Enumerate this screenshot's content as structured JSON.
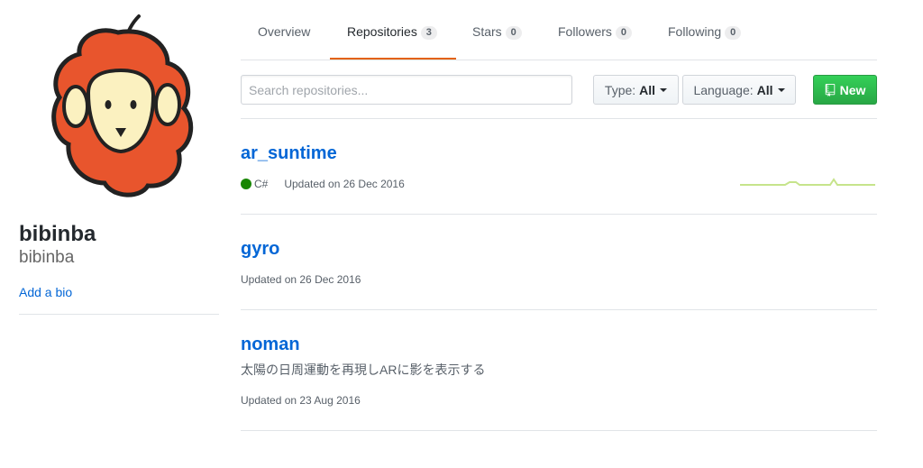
{
  "profile": {
    "fullname": "bibinba",
    "username": "bibinba",
    "add_bio": "Add a bio"
  },
  "tabs": [
    {
      "label": "Overview"
    },
    {
      "label": "Repositories",
      "count": "3"
    },
    {
      "label": "Stars",
      "count": "0"
    },
    {
      "label": "Followers",
      "count": "0"
    },
    {
      "label": "Following",
      "count": "0"
    }
  ],
  "selected_tab": "Repositories",
  "search": {
    "placeholder": "Search repositories..."
  },
  "filters": {
    "type_label": "Type:",
    "type_value": "All",
    "language_label": "Language:",
    "language_value": "All"
  },
  "new_button": "New",
  "repos": [
    {
      "name": "ar_suntime",
      "language": "C#",
      "language_color": "#178600",
      "updated": "Updated on 26 Dec 2016"
    },
    {
      "name": "gyro",
      "updated": "Updated on 26 Dec 2016"
    },
    {
      "name": "noman",
      "description": "太陽の日周運動を再現しARに影を表示する",
      "updated": "Updated on 23 Aug 2016"
    }
  ],
  "colors": {
    "accent_link": "#0366d6",
    "tab_underline": "#e36209",
    "new_button": "#28a745",
    "avatar_orange": "#e8552d",
    "avatar_face": "#fbf1c0",
    "sparkline": "#c6e48b"
  },
  "icons": {
    "new_button_icon": "repo-icon",
    "dropdown": "caret-down-icon"
  }
}
